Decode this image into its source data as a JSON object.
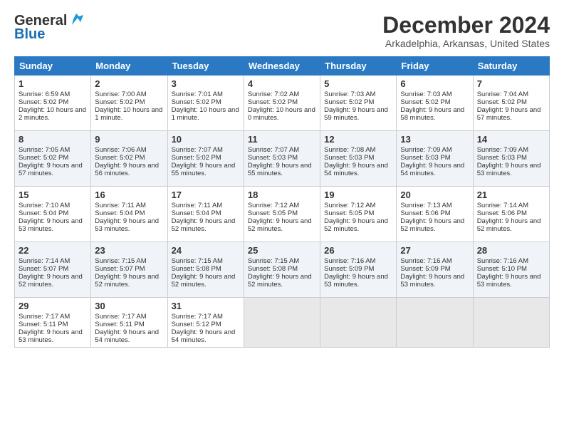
{
  "logo": {
    "line1": "General",
    "line2": "Blue"
  },
  "title": "December 2024",
  "subtitle": "Arkadelphia, Arkansas, United States",
  "headers": [
    "Sunday",
    "Monday",
    "Tuesday",
    "Wednesday",
    "Thursday",
    "Friday",
    "Saturday"
  ],
  "weeks": [
    [
      {
        "day": "1",
        "sunrise": "6:59 AM",
        "sunset": "5:02 PM",
        "daylight": "10 hours and 2 minutes."
      },
      {
        "day": "2",
        "sunrise": "7:00 AM",
        "sunset": "5:02 PM",
        "daylight": "10 hours and 1 minute."
      },
      {
        "day": "3",
        "sunrise": "7:01 AM",
        "sunset": "5:02 PM",
        "daylight": "10 hours and 1 minute."
      },
      {
        "day": "4",
        "sunrise": "7:02 AM",
        "sunset": "5:02 PM",
        "daylight": "10 hours and 0 minutes."
      },
      {
        "day": "5",
        "sunrise": "7:03 AM",
        "sunset": "5:02 PM",
        "daylight": "9 hours and 59 minutes."
      },
      {
        "day": "6",
        "sunrise": "7:03 AM",
        "sunset": "5:02 PM",
        "daylight": "9 hours and 58 minutes."
      },
      {
        "day": "7",
        "sunrise": "7:04 AM",
        "sunset": "5:02 PM",
        "daylight": "9 hours and 57 minutes."
      }
    ],
    [
      {
        "day": "8",
        "sunrise": "7:05 AM",
        "sunset": "5:02 PM",
        "daylight": "9 hours and 57 minutes."
      },
      {
        "day": "9",
        "sunrise": "7:06 AM",
        "sunset": "5:02 PM",
        "daylight": "9 hours and 56 minutes."
      },
      {
        "day": "10",
        "sunrise": "7:07 AM",
        "sunset": "5:02 PM",
        "daylight": "9 hours and 55 minutes."
      },
      {
        "day": "11",
        "sunrise": "7:07 AM",
        "sunset": "5:03 PM",
        "daylight": "9 hours and 55 minutes."
      },
      {
        "day": "12",
        "sunrise": "7:08 AM",
        "sunset": "5:03 PM",
        "daylight": "9 hours and 54 minutes."
      },
      {
        "day": "13",
        "sunrise": "7:09 AM",
        "sunset": "5:03 PM",
        "daylight": "9 hours and 54 minutes."
      },
      {
        "day": "14",
        "sunrise": "7:09 AM",
        "sunset": "5:03 PM",
        "daylight": "9 hours and 53 minutes."
      }
    ],
    [
      {
        "day": "15",
        "sunrise": "7:10 AM",
        "sunset": "5:04 PM",
        "daylight": "9 hours and 53 minutes."
      },
      {
        "day": "16",
        "sunrise": "7:11 AM",
        "sunset": "5:04 PM",
        "daylight": "9 hours and 53 minutes."
      },
      {
        "day": "17",
        "sunrise": "7:11 AM",
        "sunset": "5:04 PM",
        "daylight": "9 hours and 52 minutes."
      },
      {
        "day": "18",
        "sunrise": "7:12 AM",
        "sunset": "5:05 PM",
        "daylight": "9 hours and 52 minutes."
      },
      {
        "day": "19",
        "sunrise": "7:12 AM",
        "sunset": "5:05 PM",
        "daylight": "9 hours and 52 minutes."
      },
      {
        "day": "20",
        "sunrise": "7:13 AM",
        "sunset": "5:06 PM",
        "daylight": "9 hours and 52 minutes."
      },
      {
        "day": "21",
        "sunrise": "7:14 AM",
        "sunset": "5:06 PM",
        "daylight": "9 hours and 52 minutes."
      }
    ],
    [
      {
        "day": "22",
        "sunrise": "7:14 AM",
        "sunset": "5:07 PM",
        "daylight": "9 hours and 52 minutes."
      },
      {
        "day": "23",
        "sunrise": "7:15 AM",
        "sunset": "5:07 PM",
        "daylight": "9 hours and 52 minutes."
      },
      {
        "day": "24",
        "sunrise": "7:15 AM",
        "sunset": "5:08 PM",
        "daylight": "9 hours and 52 minutes."
      },
      {
        "day": "25",
        "sunrise": "7:15 AM",
        "sunset": "5:08 PM",
        "daylight": "9 hours and 52 minutes."
      },
      {
        "day": "26",
        "sunrise": "7:16 AM",
        "sunset": "5:09 PM",
        "daylight": "9 hours and 53 minutes."
      },
      {
        "day": "27",
        "sunrise": "7:16 AM",
        "sunset": "5:09 PM",
        "daylight": "9 hours and 53 minutes."
      },
      {
        "day": "28",
        "sunrise": "7:16 AM",
        "sunset": "5:10 PM",
        "daylight": "9 hours and 53 minutes."
      }
    ],
    [
      {
        "day": "29",
        "sunrise": "7:17 AM",
        "sunset": "5:11 PM",
        "daylight": "9 hours and 53 minutes."
      },
      {
        "day": "30",
        "sunrise": "7:17 AM",
        "sunset": "5:11 PM",
        "daylight": "9 hours and 54 minutes."
      },
      {
        "day": "31",
        "sunrise": "7:17 AM",
        "sunset": "5:12 PM",
        "daylight": "9 hours and 54 minutes."
      },
      null,
      null,
      null,
      null
    ]
  ],
  "labels": {
    "sunrise": "Sunrise:",
    "sunset": "Sunset:",
    "daylight": "Daylight:"
  }
}
